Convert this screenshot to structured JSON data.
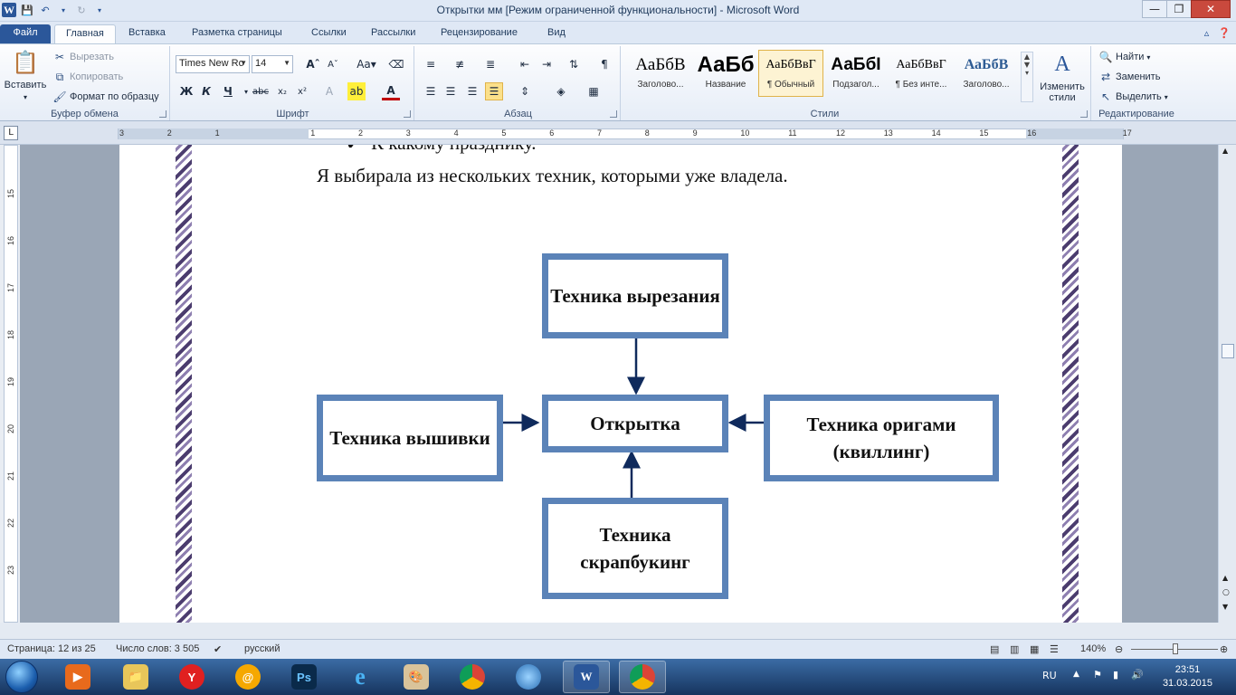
{
  "window": {
    "title": "Открытки мм [Режим ограниченной функциональности]  -  Microsoft Word"
  },
  "tabs": [
    {
      "label": "Файл"
    },
    {
      "label": "Главная"
    },
    {
      "label": "Вставка"
    },
    {
      "label": "Разметка страницы"
    },
    {
      "label": "Ссылки"
    },
    {
      "label": "Рассылки"
    },
    {
      "label": "Рецензирование"
    },
    {
      "label": "Вид"
    }
  ],
  "clipboard": {
    "paste": "Вставить",
    "cut": "Вырезать",
    "copy": "Копировать",
    "format_painter": "Формат по образцу",
    "group_label": "Буфер обмена"
  },
  "font": {
    "name": "Times New Ro",
    "size": "14",
    "group_label": "Шрифт"
  },
  "paragraph": {
    "group_label": "Абзац"
  },
  "styles": {
    "items": [
      {
        "sample": "АаБбВ",
        "name": "Заголово..."
      },
      {
        "sample": "АаБб",
        "name": "Название"
      },
      {
        "sample": "АаБбВвГ",
        "name": "¶ Обычный"
      },
      {
        "sample": "АаБбІ",
        "name": "Подзагол..."
      },
      {
        "sample": "АаБбВвГ",
        "name": "¶ Без инте..."
      },
      {
        "sample": "АаБбВ",
        "name": "Заголово..."
      }
    ],
    "change": "Изменить стили",
    "group_label": "Стили"
  },
  "editing": {
    "find": "Найти",
    "replace": "Заменить",
    "select": "Выделить",
    "group_label": "Редактирование"
  },
  "document": {
    "line1": "К какому празднику.",
    "line2": "Я выбирала из нескольких техник, которыми уже владела.",
    "diagram": {
      "top": "Техника вырезания",
      "center": "Открытка",
      "left": "Техника вышивки",
      "right": "Техника оригами (квиллинг)",
      "bottom": "Техника скрапбукинг"
    }
  },
  "statusbar": {
    "page": "Страница: 12 из 25",
    "words": "Число слов: 3 505",
    "language": "русский",
    "zoom": "140%"
  },
  "taskbar": {
    "lang": "RU",
    "time": "23:51",
    "date": "31.03.2015"
  },
  "colors": {
    "diagram_border": "#5b83b8",
    "arrow": "#0f2a5c",
    "page_border": "#4b3c6e"
  }
}
